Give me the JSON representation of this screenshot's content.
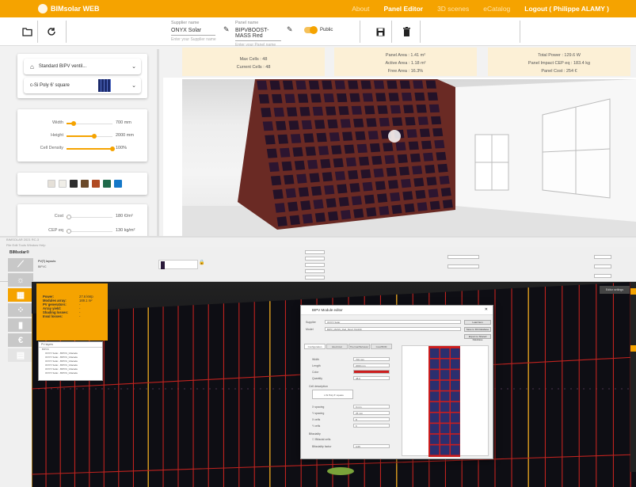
{
  "top_app": {
    "brand": "BIMsolar WEB",
    "nav": [
      "About",
      "Panel Editor",
      "3D scenes",
      "eCatalog",
      "Logout ( Philippe ALAMY )"
    ],
    "supplier": {
      "label": "Supplier name",
      "value": "ONYX Solar",
      "hint": "Enter your Supplier name"
    },
    "panel": {
      "label": "Panel name",
      "value": "BIPVBOOST-MASS Red",
      "hint": "Enter your Panel name"
    },
    "public_label": "Public",
    "product_type": "Standard BIPV ventil...",
    "cell_type": "c-Si Poly 6' square",
    "sliders": [
      {
        "label": "Width",
        "value": "700 mm",
        "fraction": 0.15
      },
      {
        "label": "Height",
        "value": "2000 mm",
        "fraction": 0.6
      },
      {
        "label": "Cell Density",
        "value": "100%",
        "fraction": 1.0
      }
    ],
    "swatch_colors": [
      "#e5e0d8",
      "#f0eee8",
      "#2e2e2e",
      "#6b4a2a",
      "#b04a22",
      "#1f6a4a",
      "#1478c8"
    ],
    "costs": [
      {
        "label": "Cost",
        "value": "180 €/m²",
        "fraction": 0.05
      },
      {
        "label": "CEP eq",
        "value": "130 kg/m²",
        "fraction": 0.05
      }
    ],
    "info": [
      {
        "lines": [
          "Max Cells : 48",
          "Current Cells : 48"
        ]
      },
      {
        "lines": [
          "Panel Area : 1.41 m²",
          "Active Area : 1.18 m²",
          "Free Area : 16.3%"
        ]
      },
      {
        "lines": [
          "Total Power : 129.6 W",
          "Panel Impact CEP eq : 183.4 kg",
          "Panel Cost : 254 €"
        ]
      }
    ]
  },
  "bottom_app": {
    "title": "BIMSOLAR  2021 RC-3",
    "menu": "File  Edit  Tools  Window  Help",
    "logo": "BIMsolar®",
    "layouts_title": "PV(T) layouts",
    "layouts_value": "BIPVC",
    "side_icons": [
      "ruler-icon",
      "sun-icon",
      "panel-icon",
      "grid-icon",
      "bar-chart-icon",
      "euro-icon",
      "document-icon"
    ],
    "pv_info": [
      {
        "k": "Power:",
        "v": "27.6 kWp"
      },
      {
        "k": "Modules array:",
        "v": "169.1 m²"
      },
      {
        "k": "PV generators:",
        "v": "-"
      },
      {
        "k": "Array yield:",
        "v": "-"
      },
      {
        "k": "Shading losses:",
        "v": "-"
      },
      {
        "k": "Inval losses:",
        "v": "-"
      }
    ],
    "layers_title": "PV layers",
    "layer_items": [
      "BIPVC",
      "ONYX Solar - BIPVC_Gfacade",
      "ONYX Solar - BIPVC_Gfacade",
      "ONYX Solar - BIPVC_Gfacade",
      "ONYX Solar - BIPVC_Gfacade",
      "ONYX Solar - BIPVC_Gfacade",
      "ONYX Solar - BIPVC_Gfacade"
    ],
    "dialog": {
      "title": "BIPV Module editor",
      "supplier_label": "Supplier",
      "supplier_value": "ONYX Solar",
      "model_label": "Model",
      "model_value": "BIPV_MASS_Red_Rev3 70x200",
      "buttons": [
        "Load Item",
        "Save to Db Database",
        "Export to Shared Database"
      ],
      "tabs": [
        "Configuration",
        "Electrical",
        "Thermal Behavior",
        "Cost/BOM"
      ],
      "fields": [
        {
          "k": "Width",
          "v": "700 mm"
        },
        {
          "k": "Length",
          "v": "2000 mm"
        },
        {
          "k": "Color",
          "v": ""
        },
        {
          "k": "Quantity",
          "v": "48.0"
        }
      ],
      "cell_label": "Cell description",
      "cell_value": "c-Si Poly 6' square",
      "layout_fields": [
        {
          "k": "X spacing",
          "v": "0 mm"
        },
        {
          "k": "Y spacing",
          "v": "25 mm"
        },
        {
          "k": "X cells",
          "v": "8"
        },
        {
          "k": "Y cells",
          "v": "6"
        }
      ],
      "bifacial": "Bifaciality",
      "bifacial_check": "Bifacial cells",
      "bifacial_factor_label": "Bifaciality factor",
      "bifacial_factor": "0.65"
    },
    "settings_label": "Editor settings"
  }
}
